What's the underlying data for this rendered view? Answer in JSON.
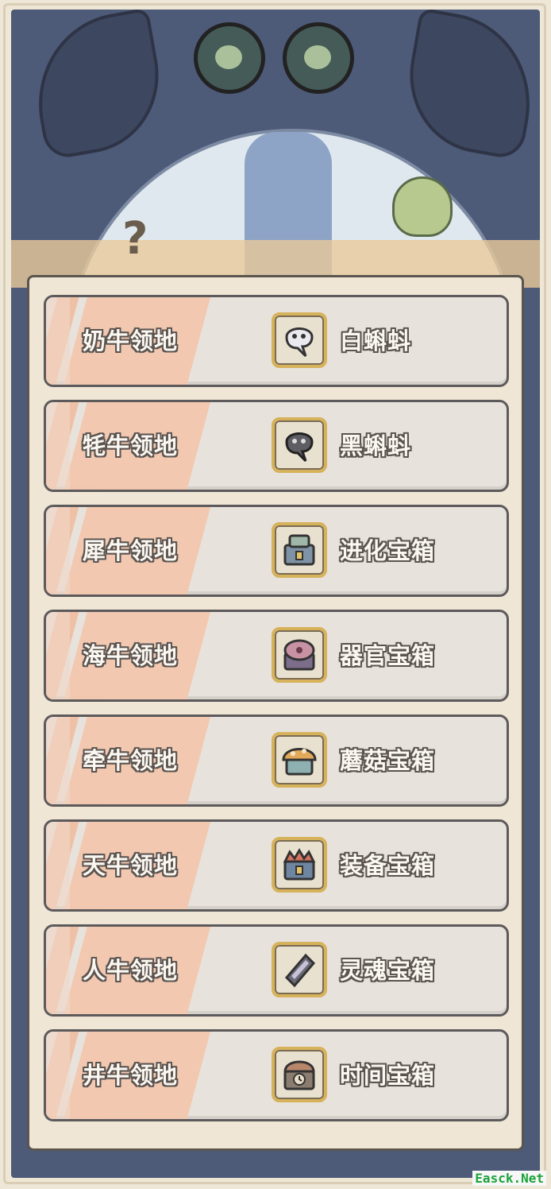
{
  "rows": [
    {
      "territory": "奶牛领地",
      "reward": "白蝌蚪",
      "icon": "white-tadpole-icon"
    },
    {
      "territory": "牦牛领地",
      "reward": "黑蝌蚪",
      "icon": "black-tadpole-icon"
    },
    {
      "territory": "犀牛领地",
      "reward": "进化宝箱",
      "icon": "evolution-chest-icon"
    },
    {
      "territory": "海牛领地",
      "reward": "器官宝箱",
      "icon": "organ-chest-icon"
    },
    {
      "territory": "牵牛领地",
      "reward": "蘑菇宝箱",
      "icon": "mushroom-chest-icon"
    },
    {
      "territory": "天牛领地",
      "reward": "装备宝箱",
      "icon": "equipment-chest-icon"
    },
    {
      "territory": "人牛领地",
      "reward": "灵魂宝箱",
      "icon": "soul-chest-icon"
    },
    {
      "territory": "井牛领地",
      "reward": "时间宝箱",
      "icon": "time-chest-icon"
    }
  ],
  "background": {
    "glyph": "?"
  },
  "watermark": "Easck.Net",
  "colors": {
    "accent_stripe": "#f3c7ae",
    "icon_border": "#d6b25b",
    "sky": "#4d5a78"
  }
}
